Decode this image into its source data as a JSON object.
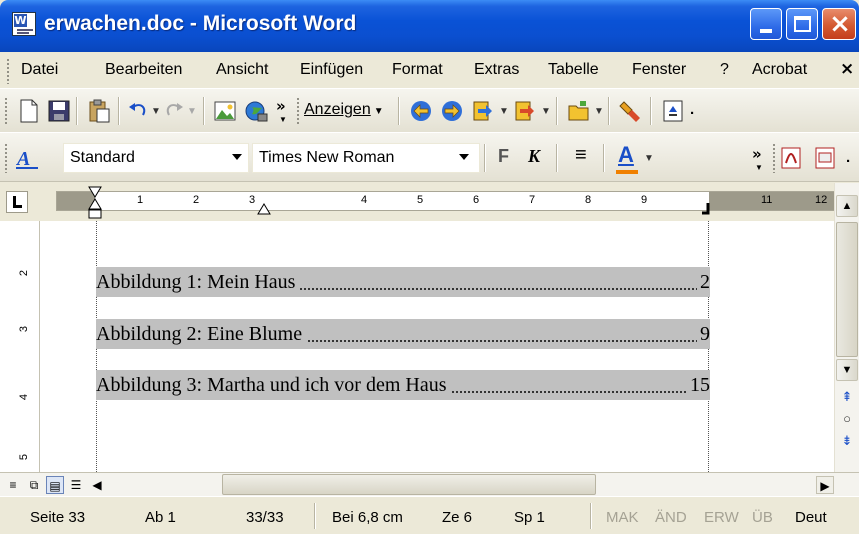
{
  "window": {
    "title": "erwachen.doc - Microsoft Word",
    "app_icon": "word-doc-icon"
  },
  "menu": {
    "items": [
      {
        "label": "Datei"
      },
      {
        "label": "Bearbeiten"
      },
      {
        "label": "Ansicht"
      },
      {
        "label": "Einfügen"
      },
      {
        "label": "Format"
      },
      {
        "label": "Extras"
      },
      {
        "label": "Tabelle"
      },
      {
        "label": "Fenster"
      },
      {
        "label": "?"
      },
      {
        "label": "Acrobat"
      }
    ],
    "close_glyph": "×"
  },
  "toolbar": {
    "show_label": "Anzeigen",
    "overflow": "»",
    "icons": [
      "new-document-icon",
      "save-icon",
      "paste-icon",
      "undo-icon",
      "redo-icon",
      "insert-picture-icon",
      "web-globe-icon",
      "back-icon",
      "forward-icon",
      "next-icon",
      "goto-icon",
      "open-folder-icon",
      "highlight-icon",
      "pdf-icon"
    ]
  },
  "formatting": {
    "style": "Standard",
    "font": "Times New Roman",
    "bold": "F",
    "italic": "K",
    "align": "≡",
    "font_color_letter": "A",
    "overflow": "»",
    "font_color": "#F08000"
  },
  "ruler": {
    "h_numbers": [
      "1",
      "2",
      "3",
      "4",
      "5",
      "6",
      "7",
      "8",
      "9",
      "11",
      "12"
    ],
    "v_numbers": [
      "2",
      "3",
      "4",
      "5"
    ]
  },
  "document": {
    "toc": [
      {
        "text": "Abbildung 1: Mein Haus",
        "page": "2"
      },
      {
        "text": "Abbildung 2: Eine Blume",
        "page": "9"
      },
      {
        "text": "Abbildung 3: Martha und ich vor dem Haus",
        "page": "15"
      }
    ],
    "highlight_color": "#C0C0C0"
  },
  "status": {
    "page": "Seite 33",
    "section": "Ab 1",
    "pages": "33/33",
    "position": "Bei 6,8 cm",
    "line": "Ze 6",
    "column": "Sp 1",
    "mak": "MAK",
    "aend": "ÄND",
    "erw": "ERW",
    "ueb": "ÜB",
    "language": "Deut"
  }
}
